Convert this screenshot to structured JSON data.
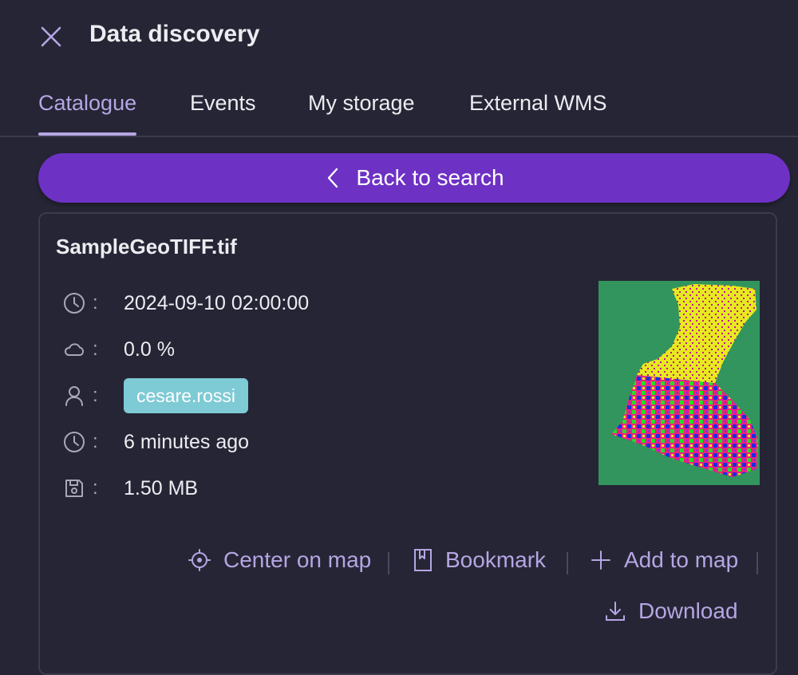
{
  "header": {
    "title": "Data discovery"
  },
  "tabs": [
    {
      "label": "Catalogue",
      "active": true
    },
    {
      "label": "Events",
      "active": false
    },
    {
      "label": "My storage",
      "active": false
    },
    {
      "label": "External WMS",
      "active": false
    }
  ],
  "back_button": {
    "label": "Back to search"
  },
  "item": {
    "file_name": "SampleGeoTIFF.tif",
    "acquisition_date": "2024-09-10 02:00:00",
    "cloud_cover": "0.0 %",
    "owner": "cesare.rossi",
    "uploaded": "6 minutes ago",
    "size": "1.50 MB"
  },
  "actions": {
    "center": "Center on map",
    "bookmark": "Bookmark",
    "add": "Add to map",
    "download": "Download"
  },
  "colors": {
    "background": "#262535",
    "accent": "#6d31c4",
    "accent_text": "#b5a6e3",
    "tag": "#7ecad5"
  },
  "icons": [
    "close-icon",
    "chevron-left-icon",
    "clock-icon",
    "cloud-icon",
    "user-icon",
    "save-icon",
    "crosshair-icon",
    "bookmark-icon",
    "plus-icon",
    "download-icon"
  ]
}
